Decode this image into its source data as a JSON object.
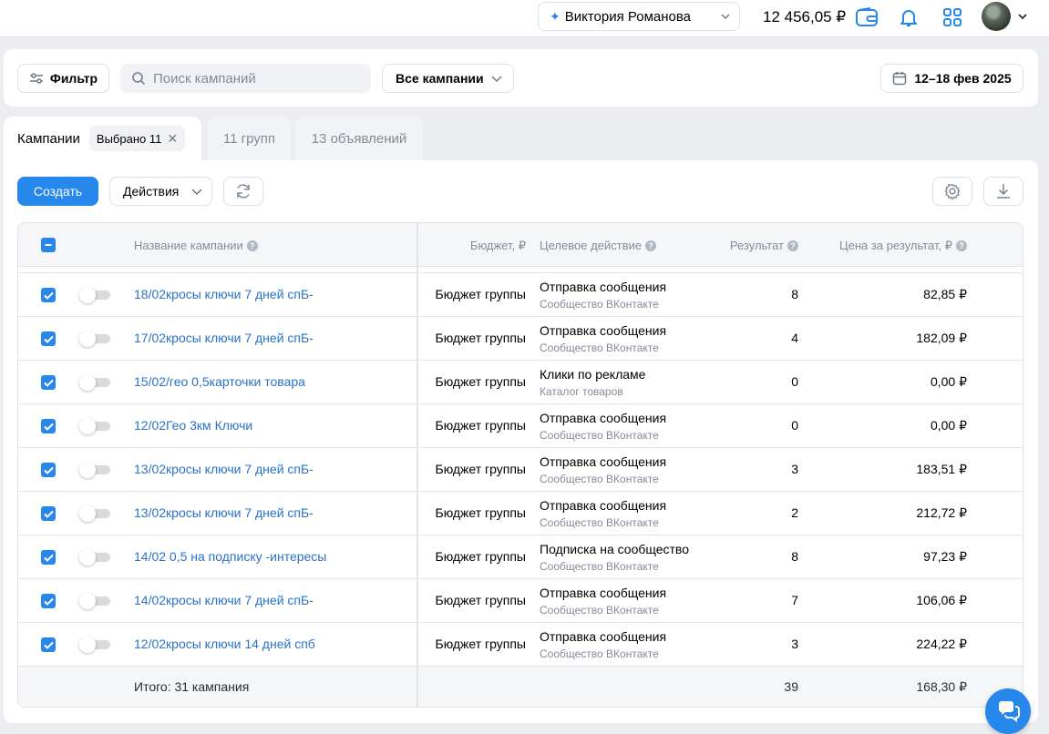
{
  "header": {
    "account_name": "Виктория Романова",
    "balance": "12 456,05 ₽",
    "icons": [
      "wallet-icon",
      "bell-icon",
      "apps-grid-icon"
    ]
  },
  "filters": {
    "filter_label": "Фильтр",
    "search_placeholder": "Поиск кампаний",
    "campaign_select": "Все кампании",
    "date_range": "12–18 фев 2025"
  },
  "tabs": {
    "campaigns": "Кампании",
    "selected_chip": "Выбрано 11",
    "groups": "11 групп",
    "ads": "13 объявлений"
  },
  "toolbar": {
    "create": "Создать",
    "actions": "Действия"
  },
  "table": {
    "headers": {
      "name": "Название кампании",
      "budget": "Бюджет, ₽",
      "goal": "Целевое действие",
      "result": "Результат",
      "price": "Цена за результат, ₽"
    },
    "rows": [
      {
        "name": "18/02кросы ключи 7 дней спБ-",
        "budget": "Бюджет группы",
        "goal": "Отправка сообщения",
        "goal_sub": "Сообщество ВКонтакте",
        "result": "8",
        "price": "82,85 ₽",
        "checked": true,
        "enabled": false
      },
      {
        "name": "17/02кросы ключи 7 дней спБ-",
        "budget": "Бюджет группы",
        "goal": "Отправка сообщения",
        "goal_sub": "Сообщество ВКонтакте",
        "result": "4",
        "price": "182,09 ₽",
        "checked": true,
        "enabled": false
      },
      {
        "name": "15/02/гео 0,5карточки товара",
        "budget": "Бюджет группы",
        "goal": "Клики по рекламе",
        "goal_sub": "Каталог товаров",
        "result": "0",
        "price": "0,00 ₽",
        "checked": true,
        "enabled": false
      },
      {
        "name": "12/02Гео 3км Ключи",
        "budget": "Бюджет группы",
        "goal": "Отправка сообщения",
        "goal_sub": "Сообщество ВКонтакте",
        "result": "0",
        "price": "0,00 ₽",
        "checked": true,
        "enabled": false
      },
      {
        "name": "13/02кросы ключи 7 дней спБ-",
        "budget": "Бюджет группы",
        "goal": "Отправка сообщения",
        "goal_sub": "Сообщество ВКонтакте",
        "result": "3",
        "price": "183,51 ₽",
        "checked": true,
        "enabled": false
      },
      {
        "name": "13/02кросы ключи 7 дней спБ-",
        "budget": "Бюджет группы",
        "goal": "Отправка сообщения",
        "goal_sub": "Сообщество ВКонтакте",
        "result": "2",
        "price": "212,72 ₽",
        "checked": true,
        "enabled": false
      },
      {
        "name": "14/02 0,5 на подписку -интересы",
        "budget": "Бюджет группы",
        "goal": "Подписка на сообщество",
        "goal_sub": "Сообщество ВКонтакте",
        "result": "8",
        "price": "97,23 ₽",
        "checked": true,
        "enabled": false
      },
      {
        "name": "14/02кросы ключи 7 дней спБ-",
        "budget": "Бюджет группы",
        "goal": "Отправка сообщения",
        "goal_sub": "Сообщество ВКонтакте",
        "result": "7",
        "price": "106,06 ₽",
        "checked": true,
        "enabled": false
      },
      {
        "name": "12/02кросы ключи 14 дней спб",
        "budget": "Бюджет группы",
        "goal": "Отправка сообщения",
        "goal_sub": "Сообщество ВКонтакте",
        "result": "3",
        "price": "224,22 ₽",
        "checked": true,
        "enabled": false
      }
    ],
    "footer": {
      "label": "Итого: 31 кампания",
      "result": "39",
      "price": "168,30 ₽"
    }
  },
  "colors": {
    "accent": "#2688eb",
    "link": "#2a72c8",
    "muted": "#818c99"
  }
}
